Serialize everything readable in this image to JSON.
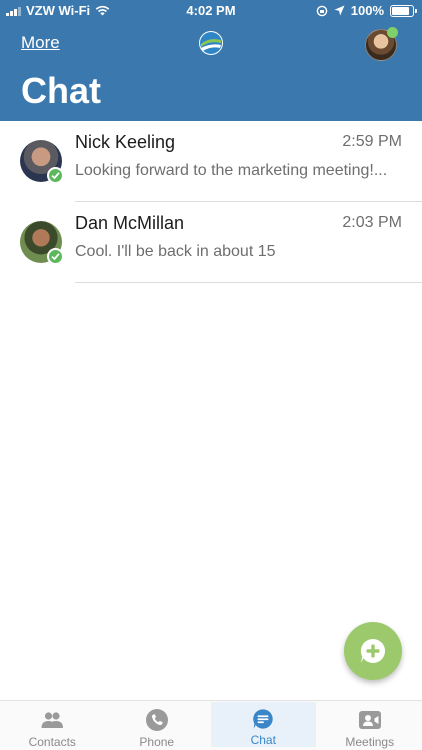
{
  "status_bar": {
    "carrier": "VZW Wi-Fi",
    "time": "4:02 PM",
    "battery": "100%",
    "battery_level": 1.0
  },
  "header": {
    "more_label": "More",
    "title": "Chat",
    "background_color": "#3b78ad"
  },
  "chats": [
    {
      "name": "Nick Keeling",
      "time": "2:59 PM",
      "preview": "Looking forward to the marketing meeting!...",
      "status": "available"
    },
    {
      "name": "Dan McMillan",
      "time": "2:03 PM",
      "preview": "Cool. I'll be back in about 15",
      "status": "available"
    }
  ],
  "fab": {
    "icon": "new-chat-icon",
    "color": "#9bc96b"
  },
  "tabs": [
    {
      "label": "Contacts",
      "icon": "contacts-icon",
      "active": false
    },
    {
      "label": "Phone",
      "icon": "phone-icon",
      "active": false
    },
    {
      "label": "Chat",
      "icon": "chat-icon",
      "active": true
    },
    {
      "label": "Meetings",
      "icon": "meetings-icon",
      "active": false
    }
  ]
}
